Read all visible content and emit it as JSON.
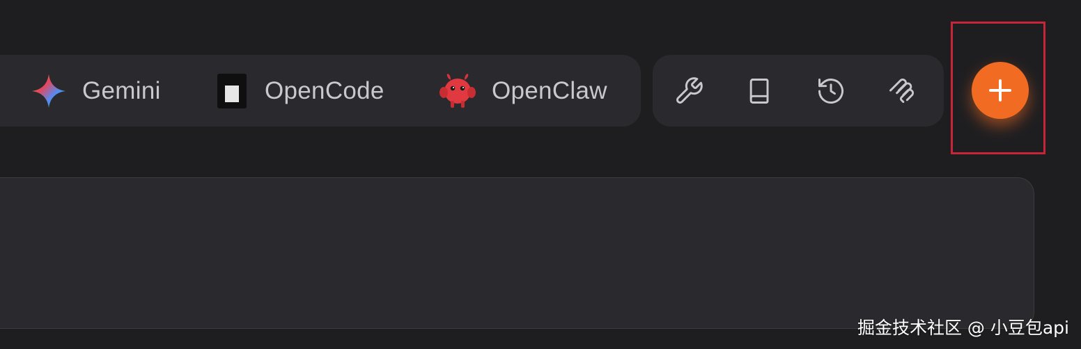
{
  "tabs": [
    {
      "id": "gemini",
      "label": "Gemini",
      "icon": "gemini-sparkle-icon"
    },
    {
      "id": "opencode",
      "label": "OpenCode",
      "icon": "opencode-icon"
    },
    {
      "id": "openclaw",
      "label": "OpenClaw",
      "icon": "openclaw-crab-icon"
    }
  ],
  "toolbar": {
    "buttons": [
      {
        "id": "settings",
        "icon": "wrench-icon"
      },
      {
        "id": "docs",
        "icon": "book-icon"
      },
      {
        "id": "history",
        "icon": "history-icon"
      },
      {
        "id": "mcp",
        "icon": "mcp-plug-icon"
      }
    ],
    "add_icon": "plus-icon"
  },
  "colors": {
    "background": "#1e1e21",
    "panel": "#2a2a2e",
    "accent": "#f26b22",
    "highlight_border": "#c8243a",
    "text": "#c8c8cd"
  },
  "watermark": "掘金技术社区 @ 小豆包api"
}
